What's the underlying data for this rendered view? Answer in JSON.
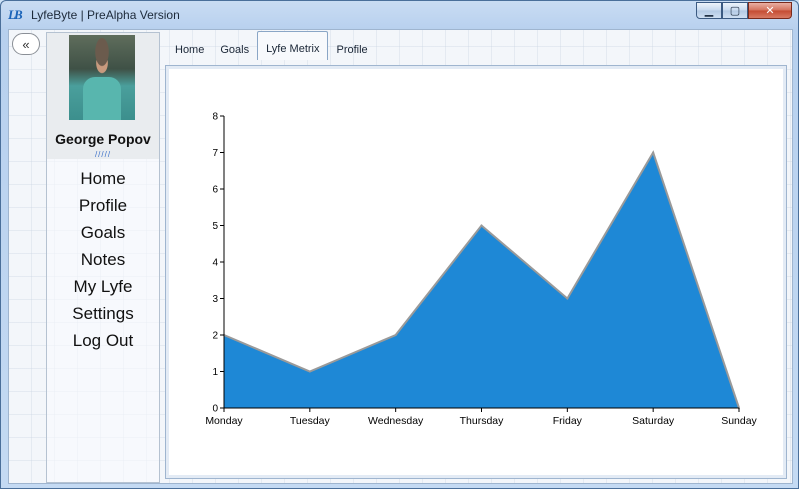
{
  "window": {
    "logo": "LB",
    "title": "LyfeByte | PreAlpha Version",
    "minimize": "▁",
    "maximize": "▢",
    "close": "✕"
  },
  "sidebar": {
    "collapse_label": "«",
    "user_name": "George Popov",
    "separator": "/////",
    "items": [
      {
        "label": "Home"
      },
      {
        "label": "Profile"
      },
      {
        "label": "Goals"
      },
      {
        "label": "Notes"
      },
      {
        "label": "My Lyfe"
      },
      {
        "label": "Settings"
      },
      {
        "label": "Log Out"
      }
    ]
  },
  "tabs": [
    {
      "label": "Home",
      "active": false
    },
    {
      "label": "Goals",
      "active": false
    },
    {
      "label": "Lyfe Metrix",
      "active": true
    },
    {
      "label": "Profile",
      "active": false
    }
  ],
  "chart_data": {
    "type": "area",
    "categories": [
      "Monday",
      "Tuesday",
      "Wednesday",
      "Thursday",
      "Friday",
      "Saturday",
      "Sunday"
    ],
    "values": [
      2,
      1,
      2,
      5,
      3,
      7,
      0
    ],
    "ylim": [
      0,
      8
    ],
    "yticks": [
      0,
      1,
      2,
      3,
      4,
      5,
      6,
      7,
      8
    ],
    "fill_color": "#1e88d6",
    "line_color": "#9a9a9a",
    "grid": false
  }
}
